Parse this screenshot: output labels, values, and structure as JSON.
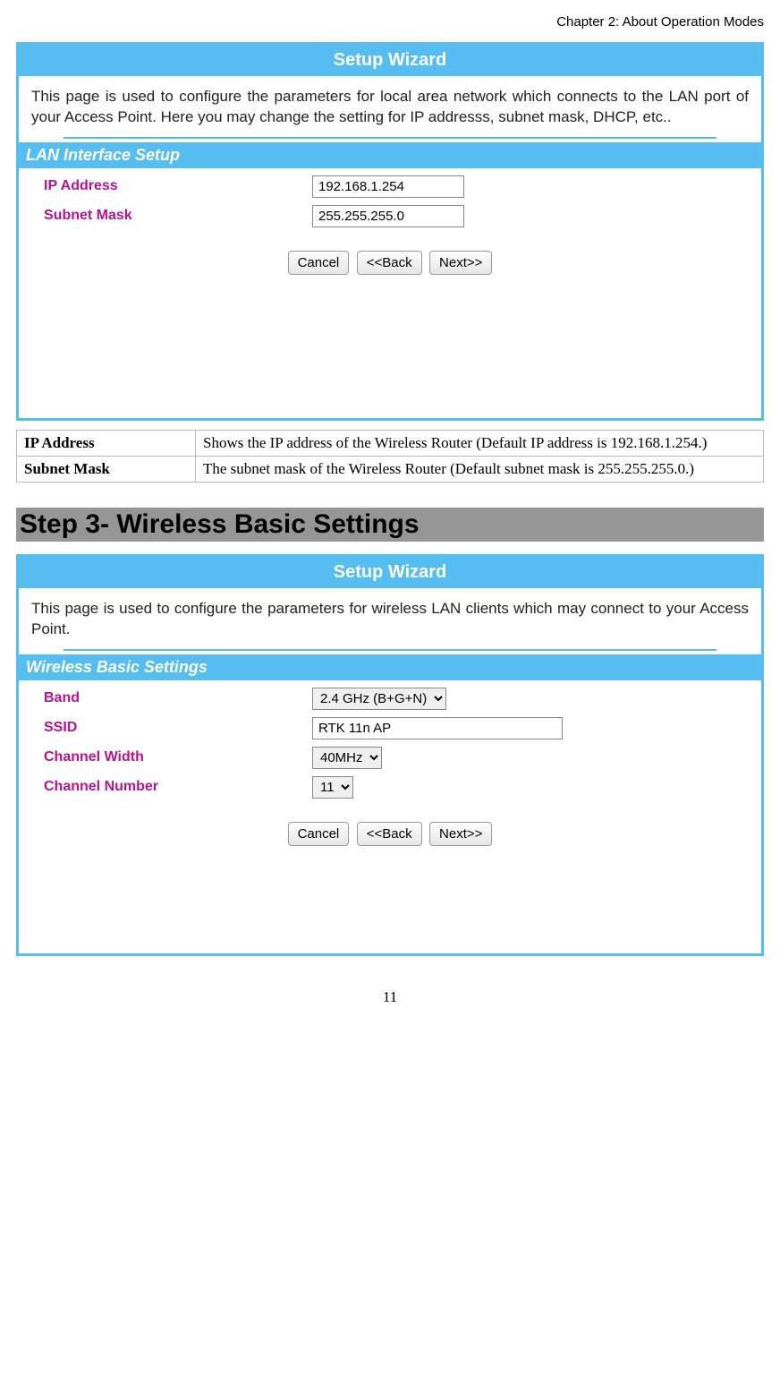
{
  "chapter": "Chapter 2: About Operation Modes",
  "wizard1": {
    "title": "Setup Wizard",
    "desc": "This page is used to configure the parameters for local area network which connects to the LAN port of your Access Point. Here you may change the setting for IP addresss, subnet mask, DHCP, etc..",
    "section": "LAN Interface Setup",
    "fields": {
      "ip_label": "IP Address",
      "ip_value": "192.168.1.254",
      "mask_label": "Subnet Mask",
      "mask_value": "255.255.255.0"
    },
    "buttons": {
      "cancel": "Cancel",
      "back": "<<Back",
      "next": "Next>>"
    }
  },
  "defs": {
    "rows": [
      {
        "term": "IP Address",
        "desc": "Shows the IP address of the Wireless Router (Default IP address is 192.168.1.254.)"
      },
      {
        "term": "Subnet Mask",
        "desc": "The subnet mask of the Wireless Router (Default subnet mask is 255.255.255.0.)"
      }
    ]
  },
  "step_heading": "Step 3- Wireless Basic Settings",
  "wizard2": {
    "title": "Setup Wizard",
    "desc": "This page is used to configure the parameters for wireless LAN clients which may connect to your Access Point.",
    "section": "Wireless Basic Settings",
    "fields": {
      "band_label": "Band",
      "band_value": "2.4 GHz (B+G+N)",
      "ssid_label": "SSID",
      "ssid_value": "RTK 11n AP",
      "chw_label": "Channel Width",
      "chw_value": "40MHz",
      "chn_label": "Channel Number",
      "chn_value": "11"
    },
    "buttons": {
      "cancel": "Cancel",
      "back": "<<Back",
      "next": "Next>>"
    }
  },
  "page_number": "11"
}
